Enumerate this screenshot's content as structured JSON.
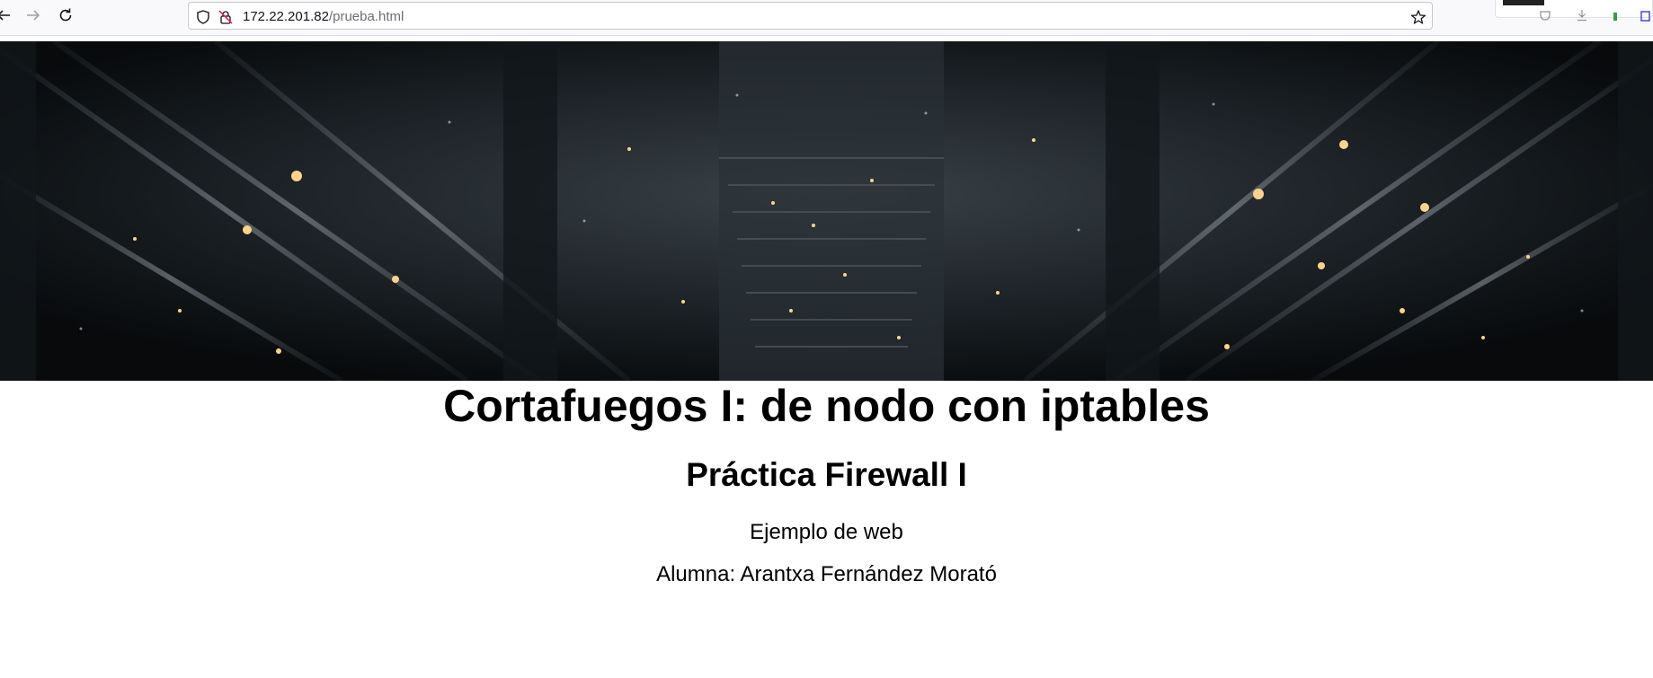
{
  "browser": {
    "url_host": "172.22.201.82",
    "url_path": "/prueba.html",
    "icons": {
      "back": "back-arrow-icon",
      "forward": "forward-arrow-icon",
      "reload": "reload-icon",
      "tracking": "shield-icon",
      "insecure": "insecure-lock-icon",
      "bookmark": "star-icon"
    }
  },
  "page": {
    "banner": {
      "description_icon": "server-corridor-image"
    },
    "title": "Cortafuegos I: de nodo con iptables",
    "subtitle": "Práctica Firewall I",
    "text1": "Ejemplo de web",
    "text2": "Alumna: Arantxa Fernández Morató"
  },
  "colors": {
    "page_bg": "#ffffff",
    "text": "#000000",
    "toolbar_bg": "#f9f9fb",
    "insecure_red": "#e22850"
  }
}
